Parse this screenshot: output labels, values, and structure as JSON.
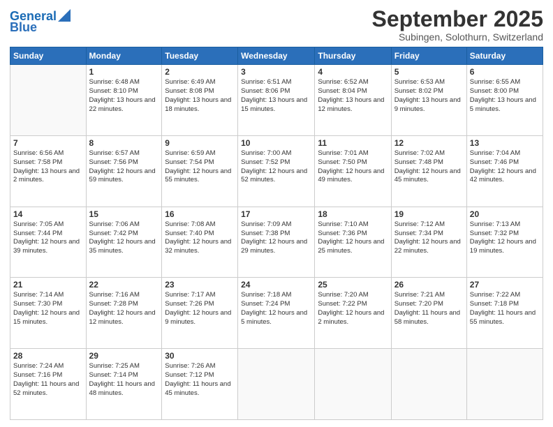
{
  "header": {
    "logo_line1": "General",
    "logo_line2": "Blue",
    "month": "September 2025",
    "location": "Subingen, Solothurn, Switzerland"
  },
  "days_of_week": [
    "Sunday",
    "Monday",
    "Tuesday",
    "Wednesday",
    "Thursday",
    "Friday",
    "Saturday"
  ],
  "weeks": [
    [
      {
        "num": "",
        "sunrise": "",
        "sunset": "",
        "daylight": ""
      },
      {
        "num": "1",
        "sunrise": "Sunrise: 6:48 AM",
        "sunset": "Sunset: 8:10 PM",
        "daylight": "Daylight: 13 hours and 22 minutes."
      },
      {
        "num": "2",
        "sunrise": "Sunrise: 6:49 AM",
        "sunset": "Sunset: 8:08 PM",
        "daylight": "Daylight: 13 hours and 18 minutes."
      },
      {
        "num": "3",
        "sunrise": "Sunrise: 6:51 AM",
        "sunset": "Sunset: 8:06 PM",
        "daylight": "Daylight: 13 hours and 15 minutes."
      },
      {
        "num": "4",
        "sunrise": "Sunrise: 6:52 AM",
        "sunset": "Sunset: 8:04 PM",
        "daylight": "Daylight: 13 hours and 12 minutes."
      },
      {
        "num": "5",
        "sunrise": "Sunrise: 6:53 AM",
        "sunset": "Sunset: 8:02 PM",
        "daylight": "Daylight: 13 hours and 9 minutes."
      },
      {
        "num": "6",
        "sunrise": "Sunrise: 6:55 AM",
        "sunset": "Sunset: 8:00 PM",
        "daylight": "Daylight: 13 hours and 5 minutes."
      }
    ],
    [
      {
        "num": "7",
        "sunrise": "Sunrise: 6:56 AM",
        "sunset": "Sunset: 7:58 PM",
        "daylight": "Daylight: 13 hours and 2 minutes."
      },
      {
        "num": "8",
        "sunrise": "Sunrise: 6:57 AM",
        "sunset": "Sunset: 7:56 PM",
        "daylight": "Daylight: 12 hours and 59 minutes."
      },
      {
        "num": "9",
        "sunrise": "Sunrise: 6:59 AM",
        "sunset": "Sunset: 7:54 PM",
        "daylight": "Daylight: 12 hours and 55 minutes."
      },
      {
        "num": "10",
        "sunrise": "Sunrise: 7:00 AM",
        "sunset": "Sunset: 7:52 PM",
        "daylight": "Daylight: 12 hours and 52 minutes."
      },
      {
        "num": "11",
        "sunrise": "Sunrise: 7:01 AM",
        "sunset": "Sunset: 7:50 PM",
        "daylight": "Daylight: 12 hours and 49 minutes."
      },
      {
        "num": "12",
        "sunrise": "Sunrise: 7:02 AM",
        "sunset": "Sunset: 7:48 PM",
        "daylight": "Daylight: 12 hours and 45 minutes."
      },
      {
        "num": "13",
        "sunrise": "Sunrise: 7:04 AM",
        "sunset": "Sunset: 7:46 PM",
        "daylight": "Daylight: 12 hours and 42 minutes."
      }
    ],
    [
      {
        "num": "14",
        "sunrise": "Sunrise: 7:05 AM",
        "sunset": "Sunset: 7:44 PM",
        "daylight": "Daylight: 12 hours and 39 minutes."
      },
      {
        "num": "15",
        "sunrise": "Sunrise: 7:06 AM",
        "sunset": "Sunset: 7:42 PM",
        "daylight": "Daylight: 12 hours and 35 minutes."
      },
      {
        "num": "16",
        "sunrise": "Sunrise: 7:08 AM",
        "sunset": "Sunset: 7:40 PM",
        "daylight": "Daylight: 12 hours and 32 minutes."
      },
      {
        "num": "17",
        "sunrise": "Sunrise: 7:09 AM",
        "sunset": "Sunset: 7:38 PM",
        "daylight": "Daylight: 12 hours and 29 minutes."
      },
      {
        "num": "18",
        "sunrise": "Sunrise: 7:10 AM",
        "sunset": "Sunset: 7:36 PM",
        "daylight": "Daylight: 12 hours and 25 minutes."
      },
      {
        "num": "19",
        "sunrise": "Sunrise: 7:12 AM",
        "sunset": "Sunset: 7:34 PM",
        "daylight": "Daylight: 12 hours and 22 minutes."
      },
      {
        "num": "20",
        "sunrise": "Sunrise: 7:13 AM",
        "sunset": "Sunset: 7:32 PM",
        "daylight": "Daylight: 12 hours and 19 minutes."
      }
    ],
    [
      {
        "num": "21",
        "sunrise": "Sunrise: 7:14 AM",
        "sunset": "Sunset: 7:30 PM",
        "daylight": "Daylight: 12 hours and 15 minutes."
      },
      {
        "num": "22",
        "sunrise": "Sunrise: 7:16 AM",
        "sunset": "Sunset: 7:28 PM",
        "daylight": "Daylight: 12 hours and 12 minutes."
      },
      {
        "num": "23",
        "sunrise": "Sunrise: 7:17 AM",
        "sunset": "Sunset: 7:26 PM",
        "daylight": "Daylight: 12 hours and 9 minutes."
      },
      {
        "num": "24",
        "sunrise": "Sunrise: 7:18 AM",
        "sunset": "Sunset: 7:24 PM",
        "daylight": "Daylight: 12 hours and 5 minutes."
      },
      {
        "num": "25",
        "sunrise": "Sunrise: 7:20 AM",
        "sunset": "Sunset: 7:22 PM",
        "daylight": "Daylight: 12 hours and 2 minutes."
      },
      {
        "num": "26",
        "sunrise": "Sunrise: 7:21 AM",
        "sunset": "Sunset: 7:20 PM",
        "daylight": "Daylight: 11 hours and 58 minutes."
      },
      {
        "num": "27",
        "sunrise": "Sunrise: 7:22 AM",
        "sunset": "Sunset: 7:18 PM",
        "daylight": "Daylight: 11 hours and 55 minutes."
      }
    ],
    [
      {
        "num": "28",
        "sunrise": "Sunrise: 7:24 AM",
        "sunset": "Sunset: 7:16 PM",
        "daylight": "Daylight: 11 hours and 52 minutes."
      },
      {
        "num": "29",
        "sunrise": "Sunrise: 7:25 AM",
        "sunset": "Sunset: 7:14 PM",
        "daylight": "Daylight: 11 hours and 48 minutes."
      },
      {
        "num": "30",
        "sunrise": "Sunrise: 7:26 AM",
        "sunset": "Sunset: 7:12 PM",
        "daylight": "Daylight: 11 hours and 45 minutes."
      },
      {
        "num": "",
        "sunrise": "",
        "sunset": "",
        "daylight": ""
      },
      {
        "num": "",
        "sunrise": "",
        "sunset": "",
        "daylight": ""
      },
      {
        "num": "",
        "sunrise": "",
        "sunset": "",
        "daylight": ""
      },
      {
        "num": "",
        "sunrise": "",
        "sunset": "",
        "daylight": ""
      }
    ]
  ]
}
